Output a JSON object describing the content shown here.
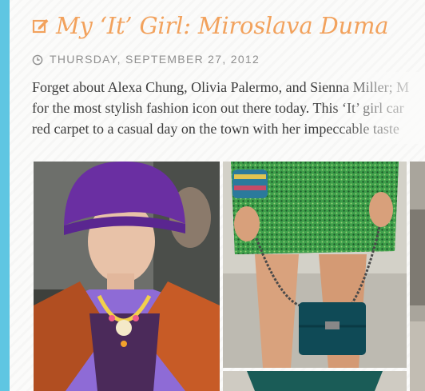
{
  "post": {
    "title": "My ‘It’ Girl: Miroslava Duma",
    "date": "THURSDAY, SEPTEMBER 27, 2012",
    "body_lines": [
      "Forget about Alexa Chung, Olivia Palermo, and Sienna Miller; M",
      "for the most stylish fashion icon out there today. This ‘It’ girl car",
      "red carpet to a casual day on the town with her impeccable taste"
    ]
  },
  "icons": {
    "title_icon": "edit-icon",
    "date_icon": "clock-icon"
  },
  "colors": {
    "accent": "#f2a25d",
    "rail": "#5fc6e2",
    "date_text": "#8f8f8f",
    "body_text": "#3c3c3c"
  }
}
